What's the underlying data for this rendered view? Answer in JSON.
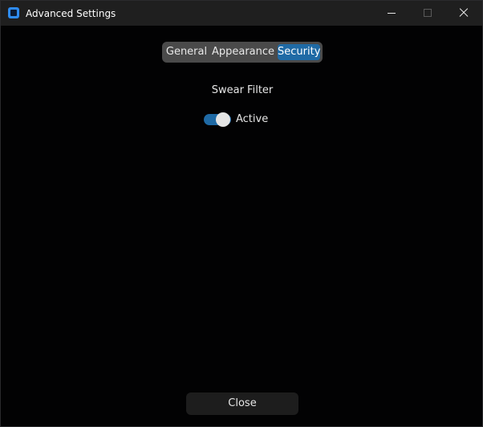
{
  "window": {
    "title": "Advanced Settings",
    "icon": "app-window-icon",
    "controls": [
      "minimize-icon",
      "maximize-icon",
      "close-icon"
    ]
  },
  "tabs": [
    {
      "label": "General",
      "selected": false
    },
    {
      "label": "Appearance",
      "selected": false
    },
    {
      "label": "Security",
      "selected": true
    }
  ],
  "security": {
    "section_title": "Swear Filter",
    "toggle": {
      "label": "Active",
      "checked": true
    }
  },
  "footer": {
    "close_label": "Close"
  },
  "colors": {
    "accent": "#1f6aa5",
    "background": "#020203",
    "titlebar": "#1f1f1f",
    "segmented_bg": "#4a4a4a",
    "button_bg": "#1d1d1d",
    "app_icon": "#2e8bf0"
  }
}
